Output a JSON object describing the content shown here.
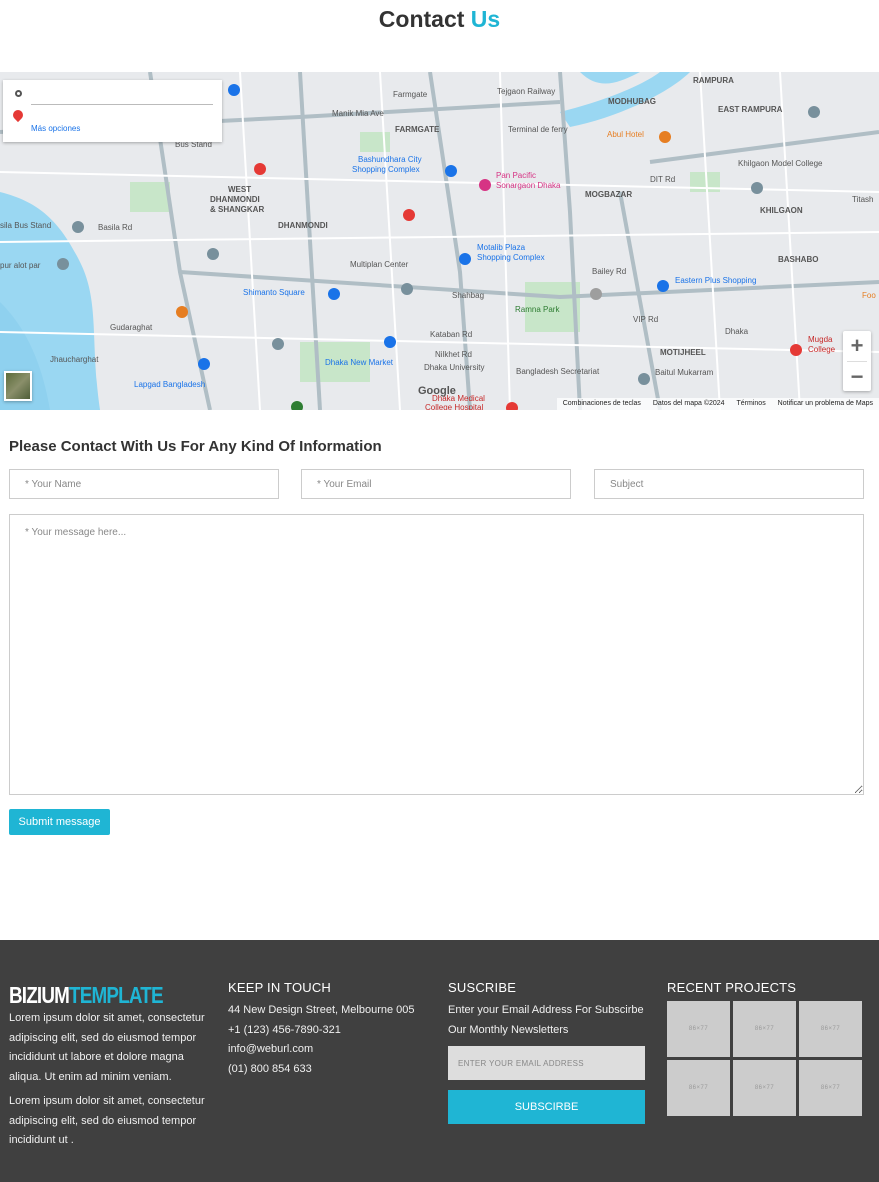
{
  "page": {
    "title_main": "Contact",
    "title_accent": "Us"
  },
  "map": {
    "directions_more": "Más opciones",
    "google_logo": "Google",
    "attribution": [
      "Combinaciones de teclas",
      "Datos del mapa ©2024",
      "Términos",
      "Notificar un problema de Maps"
    ],
    "zoom_in": "+",
    "zoom_out": "−",
    "labels": [
      "Farmgate",
      "FARMGATE",
      "Tejgaon Railway",
      "MODHUBAG",
      "EAST RAMPURA",
      "RAMPURA",
      "Abul Hotel",
      "Khilgaon Model College",
      "Bus Stand",
      "WEST DHANMONDI & SHANGKAR",
      "Bashundhara City Shopping Complex",
      "Pan Pacific Sonargaon Dhaka",
      "MOGBAZAR",
      "KHILGAON",
      "DHANMONDI",
      "Motalib Plaza Shopping Complex",
      "BASHABO",
      "sila Bus Stand",
      "Eastern Plus Shopping",
      "pur alot par",
      "Multiplan Center",
      "Shahbag",
      "Shimanto Square",
      "Ramna Park",
      "Gudaraghat",
      "Dhaka",
      "Mugda College",
      "Jhaucharghat",
      "Dhaka New Market",
      "Dhaka University",
      "Bangladesh Secretariat",
      "Baitul Mukarram",
      "MOTIJHEEL",
      "Lapgad Bangladesh",
      "Dhaka Medical College Hospital",
      "Manik Mia Ave",
      "Basila Rd",
      "Kataban Rd",
      "Nilkhet Rd",
      "VIP Rd",
      "Bailey Rd",
      "DIT Rd",
      "Titash",
      "Foo",
      "Terminal de ferry"
    ]
  },
  "form": {
    "heading": "Please Contact With Us For Any Kind Of Information",
    "name_placeholder": "* Your Name",
    "email_placeholder": "* Your Email",
    "subject_placeholder": "Subject",
    "message_placeholder": "* Your message here...",
    "submit_label": "Submit message"
  },
  "footer": {
    "logo_main": "BIZIUM",
    "logo_accent": "TEMPLATE",
    "about_p1": "Lorem ipsum dolor sit amet, consectetur adipiscing elit, sed do eiusmod tempor incididunt ut labore et dolore magna aliqua. Ut enim ad minim veniam.",
    "about_p2": "Lorem ipsum dolor sit amet, consectetur adipiscing elit, sed do eiusmod tempor incididunt ut .",
    "keep_title": "KEEP IN TOUCH",
    "address": "44 New Design Street, Melbourne 005",
    "phone": "+1 (123) 456-7890-321",
    "email": "info@weburl.com",
    "phone2": "(01) 800 854 633",
    "subscribe_title": "SUSCRIBE",
    "subscribe_text": "Enter your Email Address For Subscirbe Our Monthly Newsletters",
    "subscribe_placeholder": "ENTER YOUR EMAIL ADDRESS",
    "subscribe_button": "SUBSCIRBE",
    "projects_title": "RECENT PROJECTS",
    "thumb_label": "86×77",
    "thumbs": [
      "86×77",
      "86×77",
      "86×77",
      "86×77",
      "86×77",
      "86×77"
    ]
  }
}
